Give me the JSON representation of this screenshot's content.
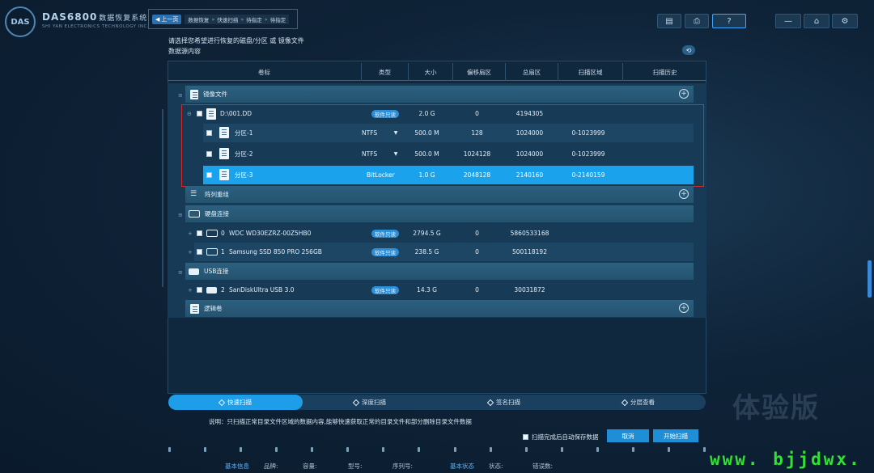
{
  "brand": {
    "logo": "DAS",
    "title": "DAS6800",
    "title_suffix": "数据恢复系统",
    "subtitle": "SHI YAN ELECTRONICS TECHNOLOGY INC."
  },
  "breadcrumb": {
    "back": "上一页",
    "items": [
      "数据恢复",
      "快速扫描",
      "待指定",
      "待指定"
    ],
    "sep": "»"
  },
  "header_icons": [
    "document-icon",
    "printer-icon",
    "help-icon",
    "minimize-icon",
    "home-icon",
    "settings-icon"
  ],
  "prompt": {
    "line1": "请选择您希望进行恢复的磁盘/分区 或 镜像文件",
    "line2": "数据源内容"
  },
  "columns": [
    "卷标",
    "类型",
    "大小",
    "偏移扇区",
    "总扇区",
    "扫描区域",
    "扫描历史"
  ],
  "groups": {
    "image": "镜像文件",
    "raid": "阵列重组",
    "hdd": "硬盘连接",
    "usb": "USB连接",
    "logical": "逻辑卷"
  },
  "image_file": {
    "label": "D:\\001.DD",
    "type": "软件只读",
    "size": "2.0 G",
    "offset": "0",
    "total": "4194305"
  },
  "partitions": [
    {
      "label": "分区-1",
      "type": "NTFS",
      "size": "500.0 M",
      "offset": "128",
      "total": "1024000",
      "range": "0-1023999"
    },
    {
      "label": "分区-2",
      "type": "NTFS",
      "size": "500.0 M",
      "offset": "1024128",
      "total": "1024000",
      "range": "0-1023999"
    },
    {
      "label": "分区-3",
      "type": "BitLocker",
      "size": "1.0 G",
      "offset": "2048128",
      "total": "2140160",
      "range": "0-2140159"
    }
  ],
  "disks": [
    {
      "index": "0",
      "label": "WDC WD30EZRZ-00Z5HB0",
      "type": "软件只读",
      "size": "2794.5 G",
      "offset": "0",
      "total": "5860533168"
    },
    {
      "index": "1",
      "label": "Samsung SSD 850 PRO 256GB",
      "type": "软件只读",
      "size": "238.5 G",
      "offset": "0",
      "total": "500118192"
    }
  ],
  "usb": [
    {
      "index": "2",
      "label": "SanDiskUltra USB 3.0",
      "type": "软件只读",
      "size": "14.3 G",
      "offset": "0",
      "total": "30031872"
    }
  ],
  "scan_tabs": [
    "快速扫描",
    "深度扫描",
    "签名扫描",
    "分层查看"
  ],
  "note": "说明：只扫描正常目录文件区域的数据内容,能够快速获取正常的目录文件和部分删除目录文件数据",
  "autosave": "扫描完成后自动保存数据",
  "buttons": {
    "cancel": "取消",
    "start": "开始扫描"
  },
  "status_bar": [
    "基本信息",
    "品牌:",
    "容量:",
    "型号:",
    "序列号:",
    "基本状态",
    "状态:",
    "错误数:"
  ],
  "watermark": "体验版",
  "site": "www. bjjdwx. com",
  "colors": {
    "selected": "#1aa3ec",
    "accent": "#1e9ee8",
    "highlight_box": "#d22a2a"
  }
}
